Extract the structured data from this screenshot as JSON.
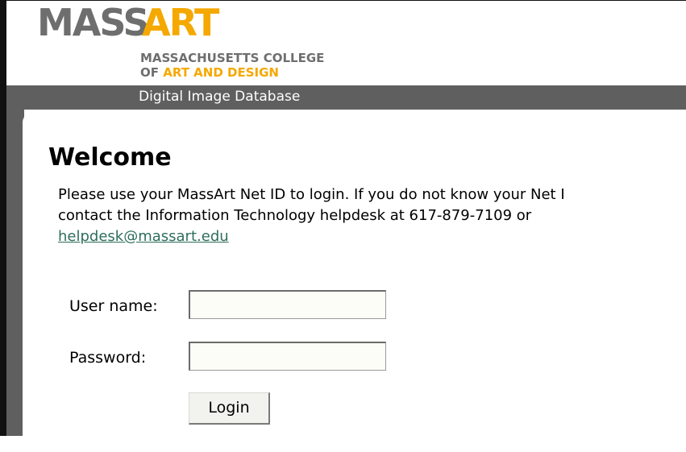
{
  "logo": {
    "mass": "MASS",
    "art": "ART",
    "line1": "MASSACHUSETTS COLLEGE",
    "line2_prefix": "OF ",
    "line2_accent": "ART AND DESIGN"
  },
  "header": {
    "title": "Digital Image Database"
  },
  "main": {
    "heading": "Welcome",
    "intro_line1": "Please use your MassArt Net ID to login. If you do not know your Net I",
    "intro_line2": "contact the Information Technology helpdesk at 617-879-7109 or",
    "helpdesk_email": "helpdesk@massart.edu"
  },
  "form": {
    "username_label": "User name:",
    "username_value": "",
    "password_label": "Password:",
    "password_value": "",
    "login_label": "Login"
  },
  "colors": {
    "brand_gray": "#6e6e6e",
    "brand_gold": "#f5a800",
    "bar_gray": "#5f5f5f",
    "link": "#2e6e5c"
  }
}
